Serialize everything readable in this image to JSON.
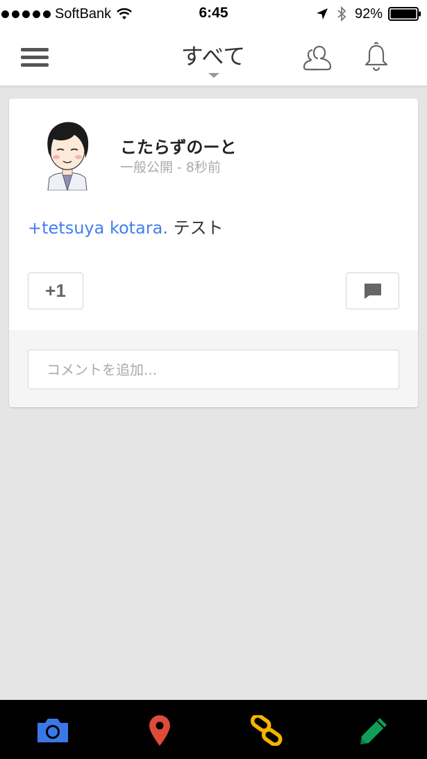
{
  "status_bar": {
    "carrier": "SoftBank",
    "time": "6:45",
    "battery": "92%",
    "signal_bars": 5,
    "battery_level": 0.92
  },
  "header": {
    "title": "すべて",
    "icons": [
      "menu-icon",
      "circles-icon",
      "bell-icon"
    ]
  },
  "post": {
    "author": "こたらずのーと",
    "meta": "一般公開 - 8秒前",
    "mention": "+tetsuya kotara.",
    "text": "テスト",
    "plusone_label": "+1",
    "comment_placeholder": "コメントを追加..."
  },
  "toolbar": {
    "items": [
      "camera-icon",
      "location-pin-icon",
      "link-icon",
      "pencil-icon"
    ]
  },
  "colors": {
    "accent_blue": "#427fed",
    "camera_blue": "#3b78e7",
    "pin_red": "#dd4b39",
    "link_yellow": "#f4b400",
    "pencil_green": "#0f9d58"
  }
}
